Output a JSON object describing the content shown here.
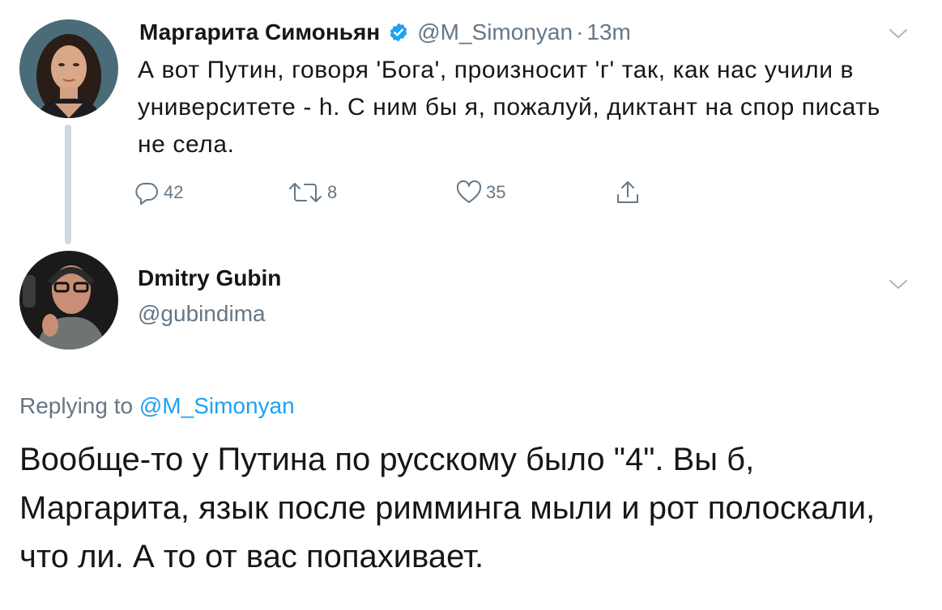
{
  "tweet1": {
    "author_name": "Маргарита Симоньян",
    "verified": true,
    "handle": "@M_Simonyan",
    "separator": "·",
    "time": "13m",
    "text": "А вот Путин, говоря 'Бога', произносит 'г' так, как нас учили в университете - h. С ним бы я, пожалуй, диктант на спор писать не села.",
    "replies": "42",
    "retweets": "8",
    "likes": "35",
    "icons": [
      "reply-icon",
      "retweet-icon",
      "like-icon",
      "share-icon",
      "chevron-down-icon",
      "verified-badge-icon"
    ]
  },
  "tweet2": {
    "author_name": "Dmitry Gubin",
    "handle": "@gubindima",
    "replying_prefix": "Replying to",
    "replying_handle": "@M_Simonyan",
    "text": "Вообще-то у Путина по русскому было \"4\". Вы б, Маргарита, язык после римминга мыли и рот полоскали, что ли. А то от вас попахивает."
  },
  "colors": {
    "text_primary": "#14171a",
    "text_secondary": "#657786",
    "accent": "#1da1f2",
    "thread_line": "#cfd9de"
  }
}
